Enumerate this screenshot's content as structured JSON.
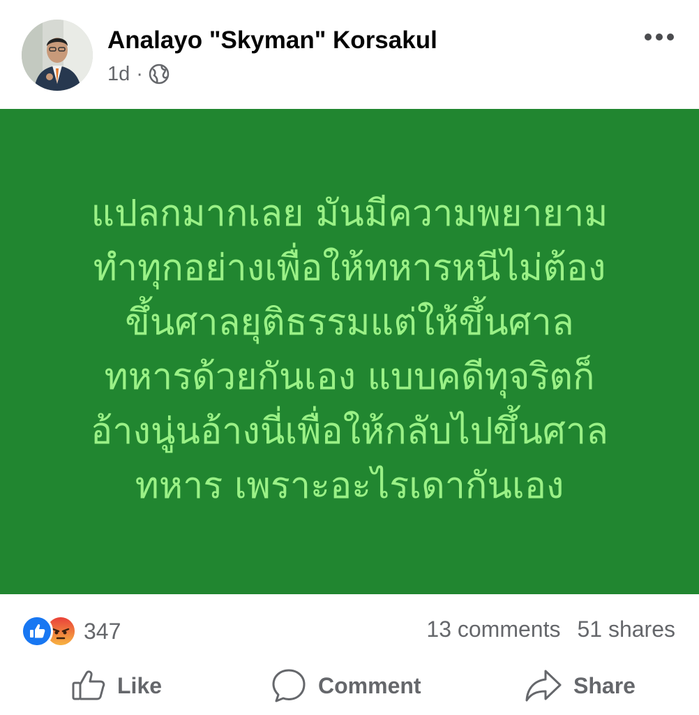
{
  "post": {
    "author": "Analayo \"Skyman\" Korsakul",
    "time": "1d",
    "separator": "·",
    "privacy_icon": "globe-icon",
    "more_icon": "more-horizontal-icon",
    "background_color": "#218630",
    "text_color": "#9af186",
    "text": "แปลกมากเลย มันมีความพยายาม\nทำทุกอย่างเพื่อให้ทหารหนีไม่ต้อง\nขึ้นศาลยุติธรรมแต่ให้ขึ้นศาล\nทหารด้วยกันเอง แบบคดีทุจริตก็\nอ้างนู่นอ้างนี่เพื่อให้กลับไปขึ้นศาล\nทหาร เพราะอะไรเดากันเอง"
  },
  "stats": {
    "reaction_icons": [
      "like-reaction-icon",
      "angry-reaction-icon"
    ],
    "reaction_count": "347",
    "comments": "13 comments",
    "shares": "51 shares"
  },
  "actions": {
    "like": "Like",
    "comment": "Comment",
    "share": "Share"
  }
}
